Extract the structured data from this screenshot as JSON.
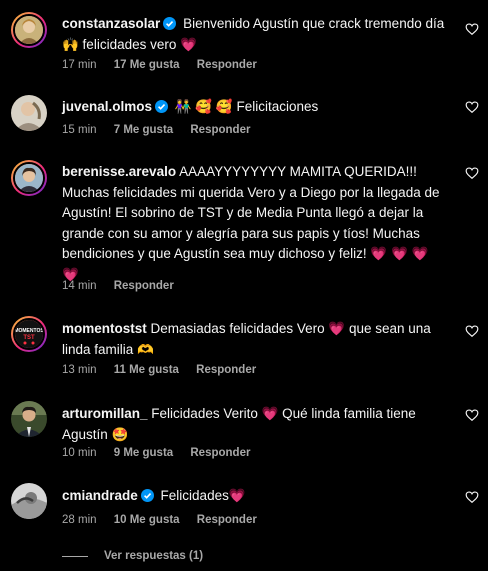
{
  "colors": {
    "background": "#000000",
    "text": "#f5f5f5",
    "muted": "#a8a8a8",
    "verified": "#0095f6",
    "heart": "#ff3040"
  },
  "comments": [
    {
      "username": "constanzasolar",
      "verified": true,
      "text_lines": [
        "Bienvenido Agustín que crack tremendo día",
        "🙌 felicidades vero 💗"
      ],
      "time": "17 min",
      "likes": "17 Me gusta",
      "reply": "Responder"
    },
    {
      "username": "juvenal.olmos",
      "verified": true,
      "text_lines": [
        "👫 🥰 🥰 Felicitaciones"
      ],
      "time": "15 min",
      "likes": "7 Me gusta",
      "reply": "Responder"
    },
    {
      "username": "berenisse.arevalo",
      "verified": false,
      "text_lines": [
        "AAAAYYYYYYYY MAMITA QUERIDA!!!",
        "Muchas felicidades mi querida Vero y a Diego por la llegada de",
        "Agustín! El sobrino de TST y de Media Punta llegó a dejar la",
        "grande con su amor y alegría para sus papis y tíos! Muchas",
        "bendiciones y que Agustín sea muy dichoso y feliz! 💗 💗 💗",
        "💗"
      ],
      "time": "14 min",
      "likes": "",
      "reply": "Responder"
    },
    {
      "username": "momentostst",
      "verified": false,
      "avatar_text": "MOMENTOS TST",
      "text_lines": [
        "Demasiadas felicidades Vero 💗 que sean una",
        "linda familia 🫶"
      ],
      "time": "13 min",
      "likes": "11 Me gusta",
      "reply": "Responder"
    },
    {
      "username": "arturomillan_",
      "verified": false,
      "text_lines": [
        "Felicidades Verito 💗 Qué linda familia tiene",
        "Agustín 🤩"
      ],
      "time": "10 min",
      "likes": "9 Me gusta",
      "reply": "Responder"
    },
    {
      "username": "cmiandrade",
      "verified": true,
      "text_lines": [
        "Felicidades💗"
      ],
      "time": "28 min",
      "likes": "10 Me gusta",
      "reply": "Responder"
    }
  ],
  "view_replies": "Ver respuestas (1)"
}
